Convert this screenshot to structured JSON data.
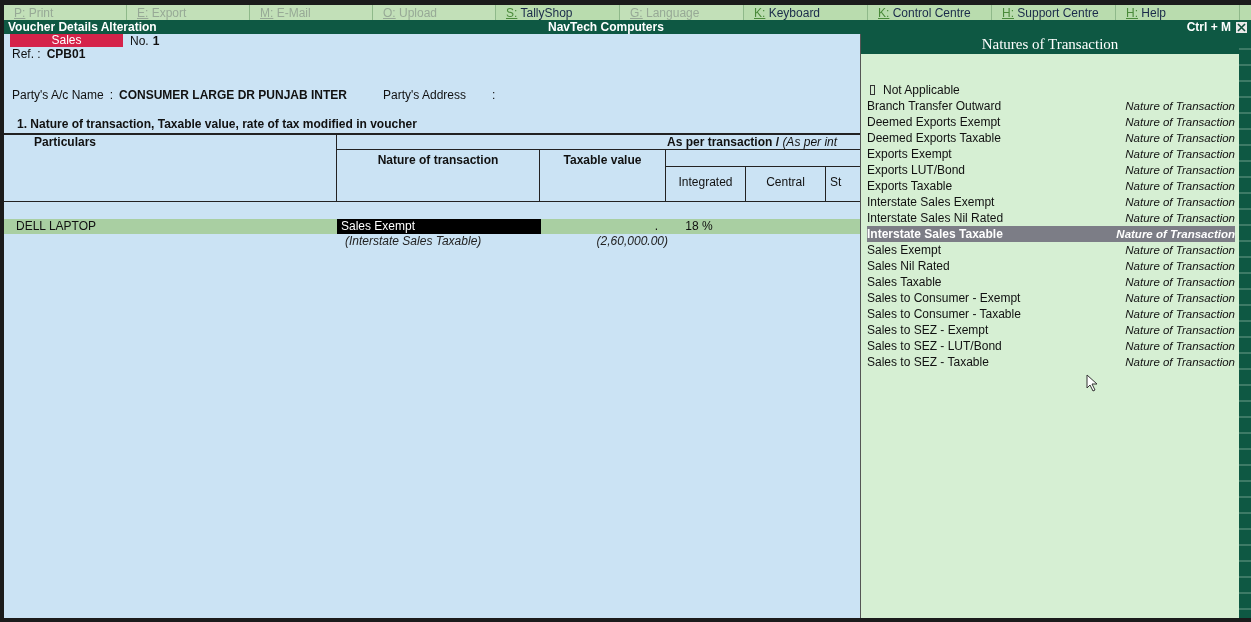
{
  "top_buttons": [
    {
      "key": "P:",
      "label": "Print",
      "disabled": true
    },
    {
      "key": "E:",
      "label": "Export",
      "disabled": true
    },
    {
      "key": "M:",
      "label": "E-Mail",
      "disabled": true
    },
    {
      "key": "O:",
      "label": "Upload",
      "disabled": true
    },
    {
      "key": "S:",
      "label": "TallyShop",
      "disabled": false
    },
    {
      "key": "G:",
      "label": "Language",
      "disabled": true
    },
    {
      "key": "K:",
      "label": "Keyboard",
      "disabled": false
    },
    {
      "key": "K:",
      "label": "Control Centre",
      "disabled": false
    },
    {
      "key": "H:",
      "label": "Support Centre",
      "disabled": false
    },
    {
      "key": "H:",
      "label": "Help",
      "disabled": false
    }
  ],
  "window": {
    "title": "Voucher Details Alteration",
    "company": "NavTech Computers",
    "shortcut": "Ctrl + M"
  },
  "voucher": {
    "type": "Sales",
    "number_label": "No.",
    "number": "1",
    "ref_label": "Ref. :",
    "ref": "CPB01",
    "party_label": "Party's A/c Name",
    "party_sep": ":",
    "party": "CONSUMER LARGE DR PUNJAB INTER",
    "address_label": "Party's Address",
    "address_sep": ":",
    "note": "1.  Nature of transaction, Taxable value, rate of tax modified in voucher"
  },
  "table": {
    "columns": {
      "particulars": "Particulars",
      "group": "**As per transaction /**  *(As per int*",
      "nature": "Nature of transaction",
      "taxable": "Taxable value",
      "sub": [
        "Integrated",
        "Central",
        "St"
      ]
    },
    "rows": [
      {
        "particulars": "DELL LAPTOP",
        "nature": "Sales Exempt",
        "taxable": ".",
        "rate": "18 %",
        "original_nature": "(Interstate Sales Taxable)",
        "original_taxable": "(2,60,000.00)"
      }
    ]
  },
  "panel": {
    "title": "Natures of Transaction",
    "items": [
      {
        "name": "Not Applicable",
        "selected": false
      },
      {
        "name": "Branch Transfer Outward",
        "category": "Nature of Transaction",
        "selected": false
      },
      {
        "name": "Deemed Exports Exempt",
        "category": "Nature of Transaction",
        "selected": false
      },
      {
        "name": "Deemed Exports Taxable",
        "category": "Nature of Transaction",
        "selected": false
      },
      {
        "name": "Exports Exempt",
        "category": "Nature of Transaction",
        "selected": false
      },
      {
        "name": "Exports LUT/Bond",
        "category": "Nature of Transaction",
        "selected": false
      },
      {
        "name": "Exports Taxable",
        "category": "Nature of Transaction",
        "selected": false
      },
      {
        "name": "Interstate Sales Exempt",
        "category": "Nature of Transaction",
        "selected": false
      },
      {
        "name": "Interstate Sales Nil Rated",
        "category": "Nature of Transaction",
        "selected": false
      },
      {
        "name": "Interstate Sales Taxable",
        "category": "Nature of Transaction",
        "selected": true
      },
      {
        "name": "Sales Exempt",
        "category": "Nature of Transaction",
        "selected": false
      },
      {
        "name": "Sales Nil Rated",
        "category": "Nature of Transaction",
        "selected": false
      },
      {
        "name": "Sales Taxable",
        "category": "Nature of Transaction",
        "selected": false
      },
      {
        "name": "Sales to Consumer - Exempt",
        "category": "Nature of Transaction",
        "selected": false
      },
      {
        "name": "Sales to Consumer - Taxable",
        "category": "Nature of Transaction",
        "selected": false
      },
      {
        "name": "Sales to SEZ - Exempt",
        "category": "Nature of Transaction",
        "selected": false
      },
      {
        "name": "Sales to SEZ - LUT/Bond",
        "category": "Nature of Transaction",
        "selected": false
      },
      {
        "name": "Sales to SEZ - Taxable",
        "category": "Nature of Transaction",
        "selected": false
      }
    ]
  }
}
